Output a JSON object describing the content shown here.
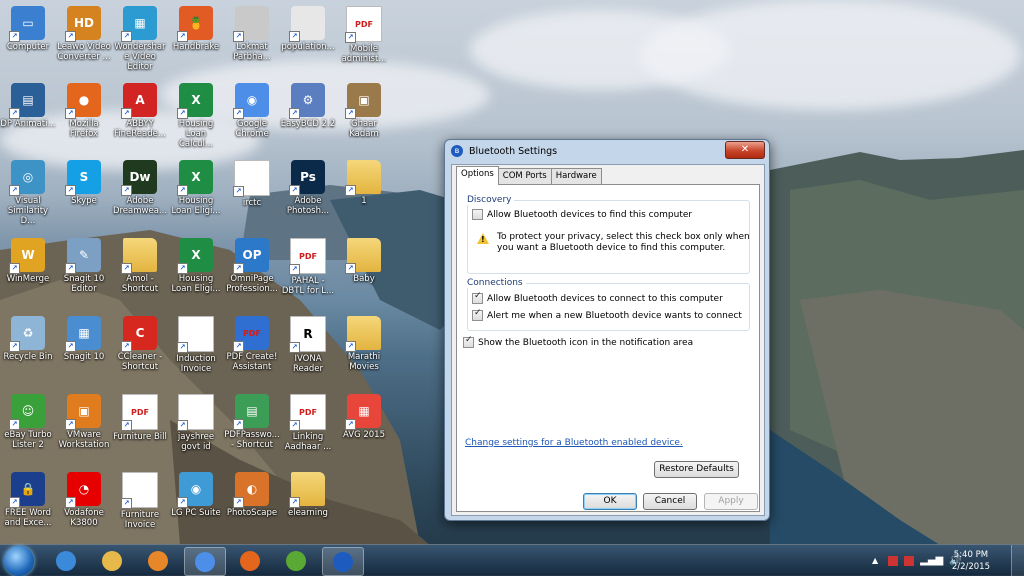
{
  "desktop": {
    "icons": [
      {
        "id": "computer",
        "label": "Computer",
        "col": 0,
        "row": 0,
        "color": "#3a7fd0",
        "glyph": "▭"
      },
      {
        "id": "leawo",
        "label": "Leawo Video Converter ...",
        "col": 1,
        "row": 0,
        "color": "#d58321",
        "glyph": "HD"
      },
      {
        "id": "wondershare",
        "label": "Wondershare Video Editor",
        "col": 2,
        "row": 0,
        "color": "#2b9bd1",
        "glyph": "▦"
      },
      {
        "id": "handbrake",
        "label": "Handbrake",
        "col": 3,
        "row": 0,
        "color": "#e25a24",
        "glyph": "🍍"
      },
      {
        "id": "lokmat",
        "label": "Lokmat Parbha...",
        "col": 4,
        "row": 0,
        "color": "#c9c9c9",
        "glyph": ""
      },
      {
        "id": "population",
        "label": "population...",
        "col": 5,
        "row": 0,
        "color": "#e7e7e7",
        "glyph": ""
      },
      {
        "id": "mobile",
        "label": "Mobile administ...",
        "col": 6,
        "row": 0,
        "color": "#ffffff",
        "glyph": "PDF"
      },
      {
        "id": "dp",
        "label": "DP Animati...",
        "col": 0,
        "row": 1,
        "color": "#2b5f97",
        "glyph": "▤"
      },
      {
        "id": "firefox1",
        "label": "Mozilla Firefox",
        "col": 1,
        "row": 1,
        "color": "#e4661c",
        "glyph": "●"
      },
      {
        "id": "abbyy",
        "label": "ABBYY FineReade...",
        "col": 2,
        "row": 1,
        "color": "#d32424",
        "glyph": "A"
      },
      {
        "id": "housing1",
        "label": "Housing Loan Calcul...",
        "col": 3,
        "row": 1,
        "color": "#1f8d44",
        "glyph": "X"
      },
      {
        "id": "chrome1",
        "label": "Google Chrome",
        "col": 4,
        "row": 1,
        "color": "#4d8ee9",
        "glyph": "◉"
      },
      {
        "id": "easybcd",
        "label": "EasyBCD 2.2",
        "col": 5,
        "row": 1,
        "color": "#5b7ec1",
        "glyph": "⚙"
      },
      {
        "id": "ghaar",
        "label": "Ghaar Kadam",
        "col": 6,
        "row": 1,
        "color": "#9a7a4a",
        "glyph": "▣"
      },
      {
        "id": "visual",
        "label": "Visual Similarity D...",
        "col": 0,
        "row": 2,
        "color": "#3d93c6",
        "glyph": "◎"
      },
      {
        "id": "skype",
        "label": "Skype",
        "col": 1,
        "row": 2,
        "color": "#15a0e6",
        "glyph": "S"
      },
      {
        "id": "dreamweaver",
        "label": "Adobe Dreamwea...",
        "col": 2,
        "row": 2,
        "color": "#1f3a1f",
        "glyph": "Dw"
      },
      {
        "id": "housing2",
        "label": "Housing Loan Eligi...",
        "col": 3,
        "row": 2,
        "color": "#1f8d44",
        "glyph": "X"
      },
      {
        "id": "irctc",
        "label": "irctc",
        "col": 4,
        "row": 2,
        "color": "#ffffff",
        "glyph": ""
      },
      {
        "id": "photoshop",
        "label": "Adobe Photosh...",
        "col": 5,
        "row": 2,
        "color": "#0b2a4a",
        "glyph": "Ps"
      },
      {
        "id": "one",
        "label": "1",
        "col": 6,
        "row": 2,
        "color": "#f0c65a",
        "glyph": ""
      },
      {
        "id": "winmerge",
        "label": "WinMerge",
        "col": 0,
        "row": 3,
        "color": "#e0a422",
        "glyph": "W"
      },
      {
        "id": "snagit10editor",
        "label": "Snagit 10 Editor",
        "col": 1,
        "row": 3,
        "color": "#7c9fc4",
        "glyph": "✎"
      },
      {
        "id": "amol",
        "label": "Amol - Shortcut",
        "col": 2,
        "row": 3,
        "color": "#f0c65a",
        "glyph": ""
      },
      {
        "id": "housing3",
        "label": "Housing Loan Eligi...",
        "col": 3,
        "row": 3,
        "color": "#1f8d44",
        "glyph": "X"
      },
      {
        "id": "omnipage",
        "label": "OmniPage Profession...",
        "col": 4,
        "row": 3,
        "color": "#2c78c9",
        "glyph": "OP"
      },
      {
        "id": "pahal",
        "label": "PAHAL - DBTL for L...",
        "col": 5,
        "row": 3,
        "color": "#ffffff",
        "glyph": "PDF"
      },
      {
        "id": "baby",
        "label": "Baby",
        "col": 6,
        "row": 3,
        "color": "#f0c65a",
        "glyph": ""
      },
      {
        "id": "recycle",
        "label": "Recycle Bin",
        "col": 0,
        "row": 4,
        "color": "#8fb5d6",
        "glyph": "♻"
      },
      {
        "id": "snagit10",
        "label": "Snagit 10",
        "col": 1,
        "row": 4,
        "color": "#4a8ed1",
        "glyph": "▦"
      },
      {
        "id": "ccleaner",
        "label": "CCleaner - Shortcut",
        "col": 2,
        "row": 4,
        "color": "#d6281f",
        "glyph": "C"
      },
      {
        "id": "induction",
        "label": "Induction Invoice",
        "col": 3,
        "row": 4,
        "color": "#ffffff",
        "glyph": ""
      },
      {
        "id": "pdfcreate",
        "label": "PDF Create! Assistant",
        "col": 4,
        "row": 4,
        "color": "#2f6fd1",
        "glyph": "PDF"
      },
      {
        "id": "ivona",
        "label": "IVONA Reader",
        "col": 5,
        "row": 4,
        "color": "#ffffff",
        "glyph": "R"
      },
      {
        "id": "marathi",
        "label": "Marathi Movies",
        "col": 6,
        "row": 4,
        "color": "#f0c65a",
        "glyph": ""
      },
      {
        "id": "ebay",
        "label": "eBay Turbo Lister 2",
        "col": 0,
        "row": 5,
        "color": "#3aa03a",
        "glyph": "☺"
      },
      {
        "id": "vmware",
        "label": "VMware Workstation",
        "col": 1,
        "row": 5,
        "color": "#e07c1e",
        "glyph": "▣"
      },
      {
        "id": "furniture1",
        "label": "Furniture Bill",
        "col": 2,
        "row": 5,
        "color": "#ffffff",
        "glyph": "PDF"
      },
      {
        "id": "jayshree",
        "label": "jayshree govt id",
        "col": 3,
        "row": 5,
        "color": "#ffffff",
        "glyph": ""
      },
      {
        "id": "pdfpassword",
        "label": "PDFPasswo... - Shortcut",
        "col": 4,
        "row": 5,
        "color": "#3c9d56",
        "glyph": "▤"
      },
      {
        "id": "linking",
        "label": "Linking Aadhaar ...",
        "col": 5,
        "row": 5,
        "color": "#ffffff",
        "glyph": "PDF"
      },
      {
        "id": "avg",
        "label": "AVG 2015",
        "col": 6,
        "row": 5,
        "color": "#e8463b",
        "glyph": "▦"
      },
      {
        "id": "freeword",
        "label": "FREE Word and Exce...",
        "col": 0,
        "row": 6,
        "color": "#1b3f8c",
        "glyph": "🔒"
      },
      {
        "id": "vodafone",
        "label": "Vodafone K3800",
        "col": 1,
        "row": 6,
        "color": "#e60000",
        "glyph": "◔"
      },
      {
        "id": "furniture2",
        "label": "Furniture Invoice",
        "col": 2,
        "row": 6,
        "color": "#ffffff",
        "glyph": ""
      },
      {
        "id": "lgpc",
        "label": "LG PC Suite",
        "col": 3,
        "row": 6,
        "color": "#3f9bd6",
        "glyph": "◉"
      },
      {
        "id": "photoscape",
        "label": "PhotoScape",
        "col": 4,
        "row": 6,
        "color": "#d9732a",
        "glyph": "◐"
      },
      {
        "id": "elearning",
        "label": "elearning",
        "col": 5,
        "row": 6,
        "color": "#f0c65a",
        "glyph": ""
      }
    ]
  },
  "dialog": {
    "title": "Bluetooth Settings",
    "close_label": "✕",
    "tabs": [
      {
        "label": "Options",
        "active": true
      },
      {
        "label": "COM Ports",
        "active": false
      },
      {
        "label": "Hardware",
        "active": false
      }
    ],
    "discovery": {
      "title": "Discovery",
      "allow_find_label": "Allow Bluetooth devices to find this computer",
      "allow_find_checked": false,
      "warning_line1": "To protect your privacy, select this check box only when",
      "warning_line2": "you want a Bluetooth device to find this computer."
    },
    "connections": {
      "title": "Connections",
      "allow_connect_label": "Allow Bluetooth devices to connect to this computer",
      "allow_connect_checked": true,
      "alert_label": "Alert me when a new Bluetooth device wants to connect",
      "alert_checked": true
    },
    "show_icon_label": "Show the Bluetooth icon in the notification area",
    "show_icon_checked": true,
    "change_link": "Change settings for a Bluetooth enabled device.",
    "restore_button": "Restore Defaults",
    "ok_button": "OK",
    "cancel_button": "Cancel",
    "apply_button": "Apply"
  },
  "taskbar": {
    "pinned": [
      {
        "id": "ie",
        "color": "#3b8ad9"
      },
      {
        "id": "explorer",
        "color": "#e6b94a"
      },
      {
        "id": "media-player",
        "color": "#e8862a"
      },
      {
        "id": "chrome",
        "color": "#4d8ee9"
      },
      {
        "id": "firefox",
        "color": "#e4661c"
      },
      {
        "id": "utorrent",
        "color": "#5aa934"
      },
      {
        "id": "bluetooth",
        "color": "#1d5bbf"
      }
    ],
    "time": "5:40 PM",
    "date": "2/2/2015"
  }
}
